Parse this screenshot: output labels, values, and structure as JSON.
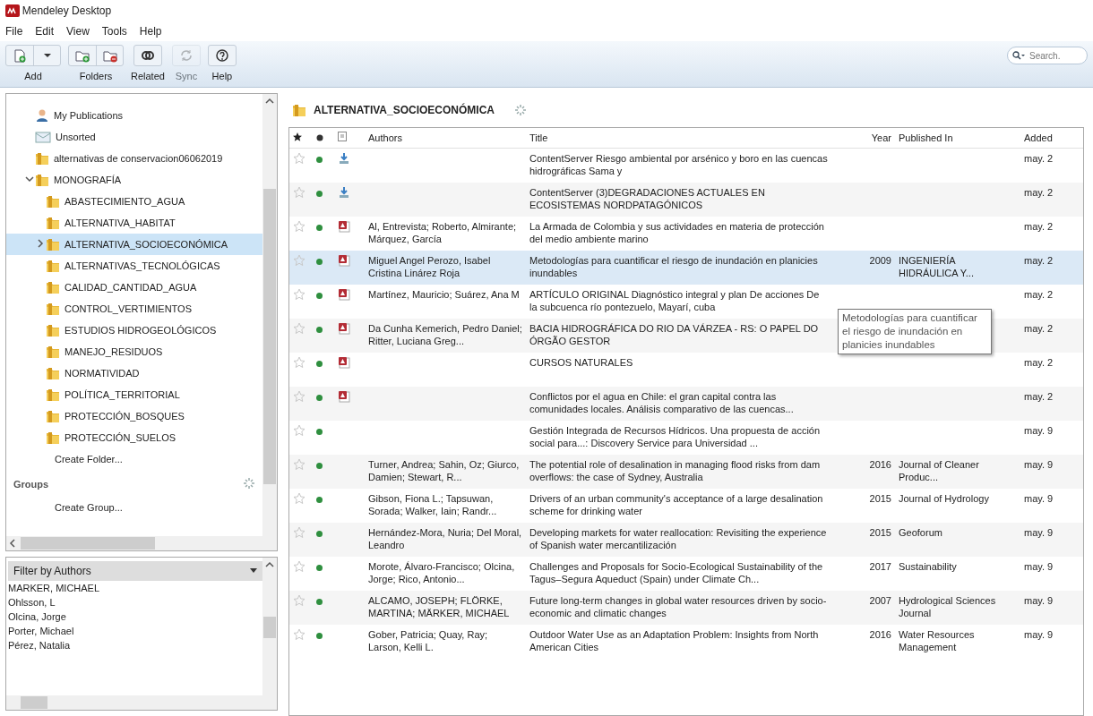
{
  "window": {
    "title": "Mendeley Desktop"
  },
  "menu": [
    "File",
    "Edit",
    "View",
    "Tools",
    "Help"
  ],
  "toolbar": [
    {
      "label": "Add",
      "kind": "add",
      "disabled": false
    },
    {
      "label": "Folders",
      "kind": "folders",
      "disabled": false
    },
    {
      "label": "Related",
      "kind": "related",
      "disabled": false
    },
    {
      "label": "Sync",
      "kind": "sync",
      "disabled": true
    },
    {
      "label": "Help",
      "kind": "help",
      "disabled": false
    }
  ],
  "search": {
    "placeholder": "Search."
  },
  "sidebar": {
    "items": [
      {
        "label": "My Publications",
        "kind": "publications",
        "selected": false
      },
      {
        "label": "Unsorted",
        "kind": "unsorted",
        "selected": false
      },
      {
        "label": "alternativas de conservacion06062019",
        "kind": "folder",
        "selected": false
      },
      {
        "label": "MONOGRAFÍA",
        "kind": "folder",
        "selected": false,
        "expanded": true,
        "children": [
          {
            "label": "ABASTECIMIENTO_AGUA",
            "kind": "folder",
            "selected": false
          },
          {
            "label": "ALTERNATIVA_HABITAT",
            "kind": "folder",
            "selected": false
          },
          {
            "label": "ALTERNATIVA_SOCIOECONÓMICA",
            "kind": "folder",
            "selected": true,
            "expanded": false
          },
          {
            "label": "ALTERNATIVAS_TECNOLÓGICAS",
            "kind": "folder",
            "selected": false
          },
          {
            "label": "CALIDAD_CANTIDAD_AGUA",
            "kind": "folder",
            "selected": false
          },
          {
            "label": "CONTROL_VERTIMIENTOS",
            "kind": "folder",
            "selected": false
          },
          {
            "label": "ESTUDIOS HIDROGEOLÓGICOS",
            "kind": "folder",
            "selected": false
          },
          {
            "label": "MANEJO_RESIDUOS",
            "kind": "folder",
            "selected": false
          },
          {
            "label": "NORMATIVIDAD",
            "kind": "folder",
            "selected": false
          },
          {
            "label": "POLÍTICA_TERRITORIAL",
            "kind": "folder",
            "selected": false
          },
          {
            "label": "PROTECCIÓN_BOSQUES",
            "kind": "folder",
            "selected": false
          },
          {
            "label": "PROTECCIÓN_SUELOS",
            "kind": "folder",
            "selected": false
          }
        ]
      },
      {
        "label": "Create Folder...",
        "kind": "create",
        "selected": false
      }
    ],
    "groups_heading": "Groups",
    "groups": [
      {
        "label": "Create Group...",
        "kind": "create",
        "selected": false
      }
    ]
  },
  "filter": {
    "label": "Filter by Authors",
    "items": [
      "MARKER, MICHAEL",
      "Ohlsson, L",
      "Olcina, Jorge",
      "Porter, Michael",
      "Pérez, Natalia"
    ]
  },
  "folder_header": {
    "title": "ALTERNATIVA_SOCIOECONÓMICA"
  },
  "table": {
    "columns": [
      "Authors",
      "Title",
      "Year",
      "Published In",
      "Added"
    ],
    "rows": [
      {
        "starred": false,
        "read": false,
        "kind": "download",
        "authors": "",
        "title": "ContentServer Riesgo ambiental por arsénico y boro en las cuencas hidrográficas Sama y",
        "year": "",
        "published": "",
        "added": "may. 2",
        "selected": false
      },
      {
        "starred": false,
        "read": false,
        "kind": "download",
        "authors": "",
        "title": "ContentServer (3)DEGRADACIONES ACTUALES EN ECOSISTEMAS NORDPATAGÓNICOS",
        "year": "",
        "published": "",
        "added": "may. 2",
        "selected": false
      },
      {
        "starred": false,
        "read": false,
        "kind": "pdf",
        "authors": "Al, Entrevista; Roberto, Almirante; Márquez, García",
        "title": "La Armada de Colombia y sus actividades en materia de protección del medio ambiente marino",
        "year": "",
        "published": "",
        "added": "may. 2",
        "selected": false
      },
      {
        "starred": false,
        "read": false,
        "kind": "pdf",
        "authors": "Miguel Angel Perozo, Isabel Cristina Linárez Roja",
        "title": "Metodologías para cuantificar el riesgo de inundación en planicies inundables",
        "year": "2009",
        "published": "INGENIERÍA HIDRÁULICA Y...",
        "added": "may. 2",
        "selected": true
      },
      {
        "starred": false,
        "read": false,
        "kind": "pdf",
        "authors": "Martínez, Mauricio; Suárez, Ana M",
        "title": "ARTÍCULO ORIGINAL Diagnóstico integral y plan De acciones De la subcuenca río pontezuelo, Mayarí, cuba",
        "year": "",
        "published": "",
        "added": "may. 2",
        "selected": false
      },
      {
        "starred": false,
        "read": false,
        "kind": "pdf",
        "authors": "Da Cunha Kemerich, Pedro Daniel; Ritter, Luciana Greg...",
        "title": "BACIA HIDROGRÁFICA DO RIO DA VÁRZEA - RS: O PAPEL DO ÓRGÃO GESTOR",
        "year": "",
        "published": "",
        "added": "may. 2",
        "selected": false
      },
      {
        "starred": false,
        "read": false,
        "kind": "pdf",
        "authors": "",
        "title": "CURSOS NATURALES",
        "year": "",
        "published": "",
        "added": "may. 2",
        "selected": false
      },
      {
        "starred": false,
        "read": false,
        "kind": "pdf",
        "authors": "",
        "title": "Conflictos por el agua en Chile: el gran capital contra las comunidades locales. Análisis comparativo de las cuencas...",
        "year": "",
        "published": "",
        "added": "may. 2",
        "selected": false
      },
      {
        "starred": false,
        "read": false,
        "kind": "none",
        "authors": "",
        "title": "Gestión Integrada de Recursos Hídricos. Una propuesta de acción social para...: Discovery Service para Universidad ...",
        "year": "",
        "published": "",
        "added": "may. 9",
        "selected": false
      },
      {
        "starred": false,
        "read": false,
        "kind": "none",
        "authors": "Turner, Andrea; Sahin, Oz; Giurco, Damien; Stewart, R...",
        "title": "The potential role of desalination in managing flood risks from dam overflows: the case of Sydney, Australia",
        "year": "2016",
        "published": "Journal of Cleaner Produc...",
        "added": "may. 9",
        "selected": false
      },
      {
        "starred": false,
        "read": false,
        "kind": "none",
        "authors": "Gibson, Fiona L.; Tapsuwan, Sorada; Walker, Iain; Randr...",
        "title": "Drivers of an urban community's acceptance of a large desalination scheme for drinking water",
        "year": "2015",
        "published": "Journal of Hydrology",
        "added": "may. 9",
        "selected": false
      },
      {
        "starred": false,
        "read": false,
        "kind": "none",
        "authors": "Hernández-Mora, Nuria; Del Moral, Leandro",
        "title": "Developing markets for water reallocation: Revisiting the experience of Spanish water mercantilización",
        "year": "2015",
        "published": "Geoforum",
        "added": "may. 9",
        "selected": false
      },
      {
        "starred": false,
        "read": false,
        "kind": "none",
        "authors": "Morote, Álvaro-Francisco; Olcina, Jorge; Rico, Antonio...",
        "title": "Challenges and Proposals for Socio-Ecological Sustainability of the Tagus–Segura Aqueduct (Spain) under Climate Ch...",
        "year": "2017",
        "published": "Sustainability",
        "added": "may. 9",
        "selected": false
      },
      {
        "starred": false,
        "read": false,
        "kind": "none",
        "authors": "ALCAMO, JOSEPH; FLÖRKE, MARTINA; MÄRKER, MICHAEL",
        "title": "Future long-term changes in global water resources driven by socio-economic and climatic changes",
        "year": "2007",
        "published": "Hydrological Sciences Journal",
        "added": "may. 9",
        "selected": false
      },
      {
        "starred": false,
        "read": false,
        "kind": "none",
        "authors": "Gober, Patricia; Quay, Ray; Larson, Kelli L.",
        "title": "Outdoor Water Use as an Adaptation Problem: Insights from North American Cities",
        "year": "2016",
        "published": "Water Resources Management",
        "added": "may. 9",
        "selected": false
      }
    ]
  },
  "tooltip": {
    "text": "Metodologías para cuantificar el riesgo de inundación en planicies inundables"
  }
}
